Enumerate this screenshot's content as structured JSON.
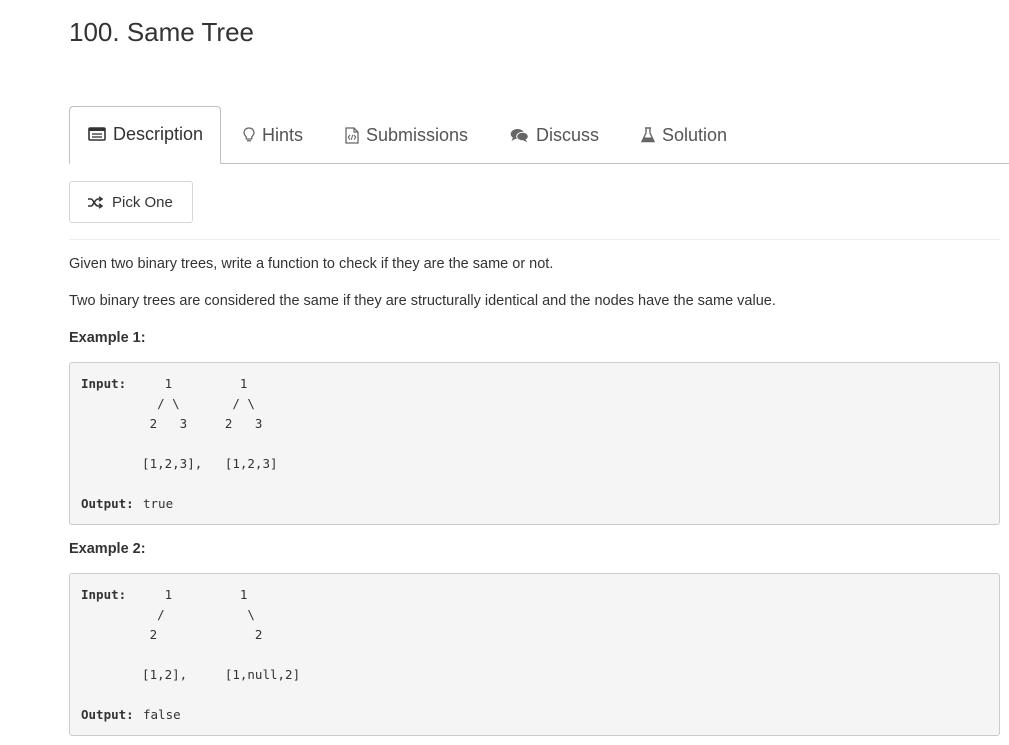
{
  "problem": {
    "title": "100. Same Tree"
  },
  "tabs": [
    {
      "label": "Description",
      "icon": "description-icon",
      "active": true
    },
    {
      "label": "Hints",
      "icon": "lightbulb-icon",
      "active": false
    },
    {
      "label": "Submissions",
      "icon": "code-file-icon",
      "active": false
    },
    {
      "label": "Discuss",
      "icon": "comments-icon",
      "active": false
    },
    {
      "label": "Solution",
      "icon": "flask-icon",
      "active": false
    }
  ],
  "pick_one": {
    "label": "Pick One",
    "icon": "shuffle-icon"
  },
  "description": {
    "para1": "Given two binary trees, write a function to check if they are the same or not.",
    "para2": "Two binary trees are considered the same if they are structurally identical and the nodes have the same value."
  },
  "examples": [
    {
      "title": "Example 1:",
      "input_label": "Input:",
      "lines": [
        "     1         1",
        "    / \\       / \\",
        "   2   3     2   3",
        "",
        "  [1,2,3],   [1,2,3]"
      ],
      "output_label": "Output:",
      "output_value": "true"
    },
    {
      "title": "Example 2:",
      "input_label": "Input:",
      "lines": [
        "     1         1",
        "    /           \\",
        "   2             2",
        "",
        "  [1,2],     [1,null,2]"
      ],
      "output_label": "Output:",
      "output_value": "false"
    }
  ],
  "colors": {
    "text": "#333333",
    "tab_text": "#555555",
    "border": "#bfbfbf",
    "code_bg": "#f5f5f5"
  }
}
